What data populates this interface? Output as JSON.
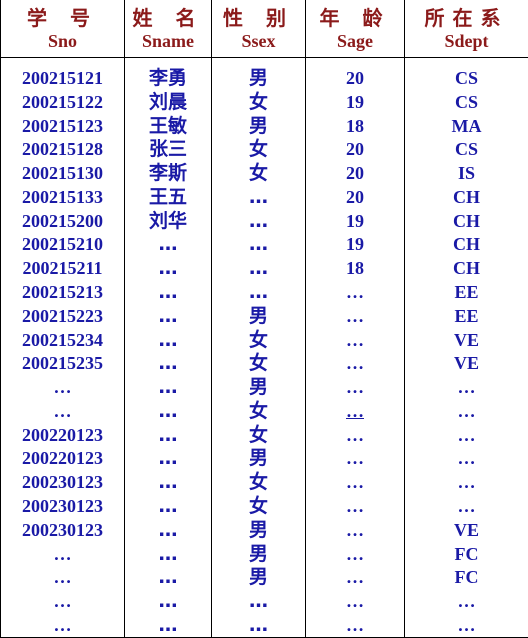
{
  "headers": [
    {
      "zh": "学 号",
      "en": "Sno"
    },
    {
      "zh": "姓 名",
      "en": "Sname"
    },
    {
      "zh": "性 别",
      "en": "Ssex"
    },
    {
      "zh": "年 龄",
      "en": "Sage"
    },
    {
      "zh": "所在系",
      "en": "Sdept"
    }
  ],
  "rows": [
    [
      "200215121",
      "李勇",
      "男",
      "20",
      "CS"
    ],
    [
      "200215122",
      "刘晨",
      "女",
      "19",
      "CS"
    ],
    [
      "200215123",
      "王敏",
      "男",
      "18",
      "MA"
    ],
    [
      "200215128",
      "张三",
      "女",
      "20",
      "CS"
    ],
    [
      "200215130",
      "李斯",
      "女",
      "20",
      "IS"
    ],
    [
      "200215133",
      "王五",
      "…",
      "20",
      "CH"
    ],
    [
      "200215200",
      "刘华",
      "…",
      "19",
      "CH"
    ],
    [
      "200215210",
      "…",
      "…",
      "19",
      "CH"
    ],
    [
      "200215211",
      "…",
      "…",
      "18",
      "CH"
    ],
    [
      "200215213",
      "…",
      "…",
      "…",
      "EE"
    ],
    [
      "200215223",
      "…",
      "男",
      "…",
      "EE"
    ],
    [
      "200215234",
      "…",
      "女",
      "…",
      "VE"
    ],
    [
      "200215235",
      "…",
      "女",
      "…",
      "VE"
    ],
    [
      "…",
      "…",
      "男",
      "…",
      "…"
    ],
    [
      "…",
      "…",
      "女",
      "…",
      "…"
    ],
    [
      "200220123",
      "…",
      "女",
      "…",
      "…"
    ],
    [
      "200220123",
      "…",
      "男",
      "…",
      "…"
    ],
    [
      "200230123",
      "…",
      "女",
      "…",
      "…"
    ],
    [
      "200230123",
      "…",
      "女",
      "…",
      "…"
    ],
    [
      "200230123",
      "…",
      "男",
      "…",
      "VE"
    ],
    [
      "…",
      "…",
      "男",
      "…",
      "FC"
    ],
    [
      "…",
      "…",
      "男",
      "…",
      "FC"
    ],
    [
      "…",
      "…",
      "…",
      "…",
      "…"
    ],
    [
      "…",
      "…",
      "…",
      "…",
      "…"
    ]
  ],
  "colors": {
    "header": "#8b1a1a",
    "body": "#1a1aa6"
  }
}
